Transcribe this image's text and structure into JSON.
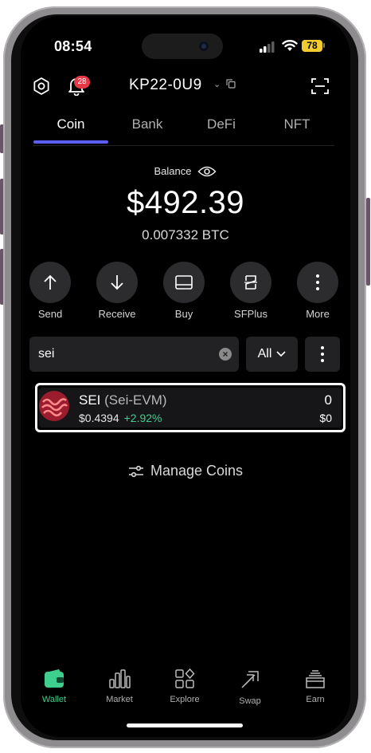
{
  "status_bar": {
    "time": "08:54",
    "battery": "78"
  },
  "header": {
    "notification_count": "28",
    "wallet_name": "KP22-0U9"
  },
  "tabs": [
    {
      "label": "Coin"
    },
    {
      "label": "Bank"
    },
    {
      "label": "DeFi"
    },
    {
      "label": "NFT"
    }
  ],
  "balance": {
    "label": "Balance",
    "amount": "$492.39",
    "btc": "0.007332 BTC"
  },
  "actions": [
    {
      "label": "Send",
      "icon": "arrow-up-icon"
    },
    {
      "label": "Receive",
      "icon": "arrow-down-icon"
    },
    {
      "label": "Buy",
      "icon": "card-icon"
    },
    {
      "label": "SFPlus",
      "icon": "sfplus-icon"
    },
    {
      "label": "More",
      "icon": "more-vertical-icon"
    }
  ],
  "search": {
    "value": "sei"
  },
  "filter": {
    "selected": "All"
  },
  "coin": {
    "symbol": "SEI",
    "network": "(Sei-EVM)",
    "price": "$0.4394",
    "change": "+2.92%",
    "quantity": "0",
    "value": "$0"
  },
  "manage_coins": {
    "label": "Manage Coins"
  },
  "bottom_nav": [
    {
      "label": "Wallet",
      "icon": "wallet-icon"
    },
    {
      "label": "Market",
      "icon": "market-icon"
    },
    {
      "label": "Explore",
      "icon": "explore-icon"
    },
    {
      "label": "Swap",
      "icon": "swap-icon"
    },
    {
      "label": "Earn",
      "icon": "earn-icon"
    }
  ],
  "colors": {
    "accent": "#5b5ef4",
    "positive": "#3ecf8e",
    "badge": "#e63946",
    "battery": "#f2cc2e"
  }
}
